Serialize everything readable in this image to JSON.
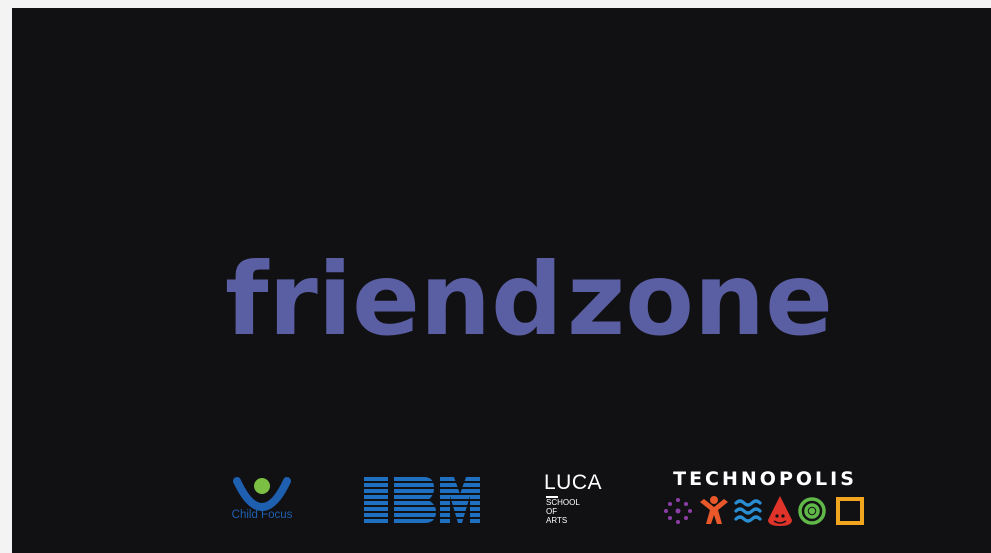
{
  "title": {
    "word1": "friend",
    "word2": "zone"
  },
  "logos": {
    "child_focus": {
      "label": "Child Focus"
    },
    "ibm": {
      "label": "IBM"
    },
    "luca": {
      "main": "LUCA",
      "lines": [
        "SCHOOL",
        "OF",
        "ARTS"
      ]
    },
    "technopolis": {
      "label": "TECHNOPOLIS"
    }
  },
  "colors": {
    "background": "#111114",
    "title": "#5a5ea3",
    "ibm_blue": "#1f70c1",
    "child_focus_blue": "#1e5fb0",
    "child_focus_green": "#7bc043"
  }
}
